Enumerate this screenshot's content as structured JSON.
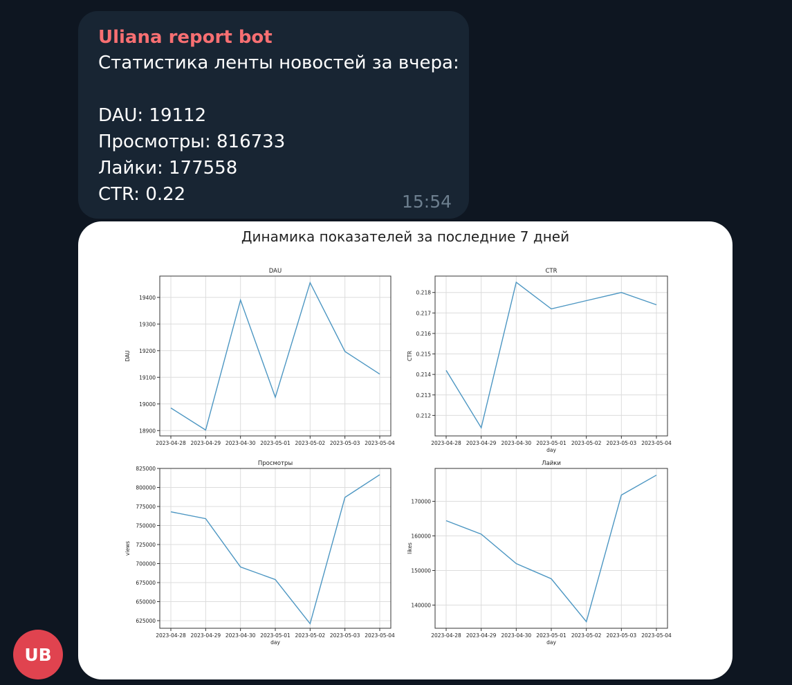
{
  "message": {
    "sender": "Uliana report bot",
    "lines": [
      "Статистика ленты новостей за вчера:",
      "DAU: 19112",
      "Просмотры: 816733",
      "Лайки: 177558",
      "CTR: 0.22"
    ],
    "time": "15:54"
  },
  "avatar": {
    "initials": "UB",
    "color": "#e0434f"
  },
  "colors": {
    "background": "#0e1621",
    "bubble": "#182533",
    "sender": "#f76f72",
    "line": "#4c96c2"
  },
  "figure": {
    "suptitle": "Динамика показателей за последние 7 дней"
  },
  "chart_data": [
    {
      "type": "line",
      "title": "DAU",
      "xlabel": "",
      "ylabel": "DAU",
      "x": [
        "2023-04-28",
        "2023-04-29",
        "2023-04-30",
        "2023-05-01",
        "2023-05-02",
        "2023-05-03",
        "2023-05-04"
      ],
      "values": [
        18985,
        18902,
        19390,
        19025,
        19455,
        19197,
        19112
      ],
      "ylim": [
        18880,
        19480
      ],
      "yticks": [
        18900,
        19000,
        19100,
        19200,
        19300,
        19400
      ],
      "grid": true
    },
    {
      "type": "line",
      "title": "CTR",
      "xlabel": "day",
      "ylabel": "CTR",
      "x": [
        "2023-04-28",
        "2023-04-29",
        "2023-04-30",
        "2023-05-01",
        "2023-05-02",
        "2023-05-03",
        "2023-05-04"
      ],
      "values": [
        0.2142,
        0.2114,
        0.2185,
        0.2172,
        0.2176,
        0.218,
        0.2174
      ],
      "ylim": [
        0.211,
        0.2188
      ],
      "yticks": [
        0.212,
        0.213,
        0.214,
        0.215,
        0.216,
        0.217,
        0.218
      ],
      "grid": true
    },
    {
      "type": "line",
      "title": "Просмотры",
      "xlabel": "day",
      "ylabel": "views",
      "x": [
        "2023-04-28",
        "2023-04-29",
        "2023-04-30",
        "2023-05-01",
        "2023-05-02",
        "2023-05-03",
        "2023-05-04"
      ],
      "values": [
        768000,
        759000,
        695500,
        679000,
        621000,
        787000,
        816733
      ],
      "ylim": [
        615000,
        825000
      ],
      "yticks": [
        625000,
        650000,
        675000,
        700000,
        725000,
        750000,
        775000,
        800000,
        825000
      ],
      "grid": true
    },
    {
      "type": "line",
      "title": "Лайки",
      "xlabel": "day",
      "ylabel": "likes",
      "x": [
        "2023-04-28",
        "2023-04-29",
        "2023-04-30",
        "2023-05-01",
        "2023-05-02",
        "2023-05-03",
        "2023-05-04"
      ],
      "values": [
        164400,
        160500,
        152000,
        147600,
        135200,
        171800,
        177558
      ],
      "ylim": [
        133300,
        179500
      ],
      "yticks": [
        140000,
        150000,
        160000,
        170000
      ],
      "grid": true
    }
  ]
}
